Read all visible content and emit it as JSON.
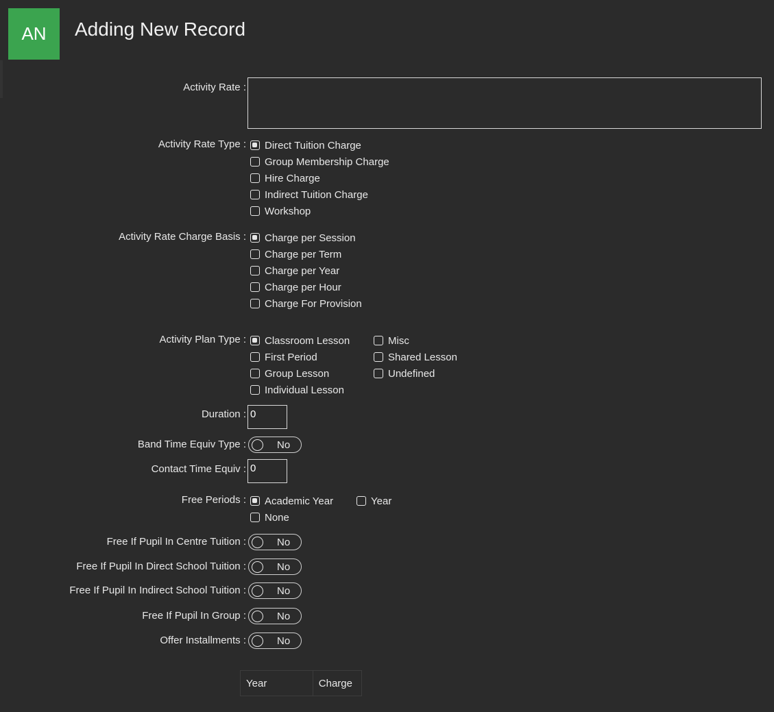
{
  "header": {
    "avatar_initials": "AN",
    "title": "Adding New Record"
  },
  "form": {
    "activity_rate": {
      "label": "Activity Rate :",
      "value": ""
    },
    "rate_type": {
      "label": "Activity Rate Type :",
      "options": [
        {
          "label": "Direct Tuition Charge",
          "checked": true
        },
        {
          "label": "Group Membership Charge",
          "checked": false
        },
        {
          "label": "Hire Charge",
          "checked": false
        },
        {
          "label": "Indirect Tuition Charge",
          "checked": false
        },
        {
          "label": "Workshop",
          "checked": false
        }
      ]
    },
    "charge_basis": {
      "label": "Activity Rate Charge Basis :",
      "options": [
        {
          "label": "Charge per Session",
          "checked": true
        },
        {
          "label": "Charge per Term",
          "checked": false
        },
        {
          "label": "Charge per Year",
          "checked": false
        },
        {
          "label": "Charge per Hour",
          "checked": false
        },
        {
          "label": "Charge For Provision",
          "checked": false
        }
      ]
    },
    "plan_type": {
      "label": "Activity Plan Type :",
      "options": [
        {
          "label": "Classroom Lesson",
          "checked": true
        },
        {
          "label": "First Period",
          "checked": false
        },
        {
          "label": "Group Lesson",
          "checked": false
        },
        {
          "label": "Individual Lesson",
          "checked": false
        },
        {
          "label": "Misc",
          "checked": false
        },
        {
          "label": "Shared Lesson",
          "checked": false
        },
        {
          "label": "Undefined",
          "checked": false
        }
      ]
    },
    "duration": {
      "label": "Duration :",
      "value": "0"
    },
    "band_time": {
      "label": "Band Time Equiv Type :",
      "value": "No"
    },
    "contact_time": {
      "label": "Contact Time Equiv :",
      "value": "0"
    },
    "free_periods": {
      "label": "Free Periods :",
      "options": [
        {
          "label": "Academic Year",
          "checked": true
        },
        {
          "label": "Year",
          "checked": false
        },
        {
          "label": "None",
          "checked": false
        }
      ]
    },
    "free_centre": {
      "label": "Free If Pupil In Centre Tuition :",
      "value": "No"
    },
    "free_direct": {
      "label": "Free If Pupil In Direct School Tuition :",
      "value": "No"
    },
    "free_indirect": {
      "label": "Free If Pupil In Indirect School Tuition :",
      "value": "No"
    },
    "free_group": {
      "label": "Free If Pupil In Group :",
      "value": "No"
    },
    "installments": {
      "label": "Offer Installments :",
      "value": "No"
    }
  },
  "grid": {
    "columns": [
      "Year",
      "Charge"
    ]
  }
}
